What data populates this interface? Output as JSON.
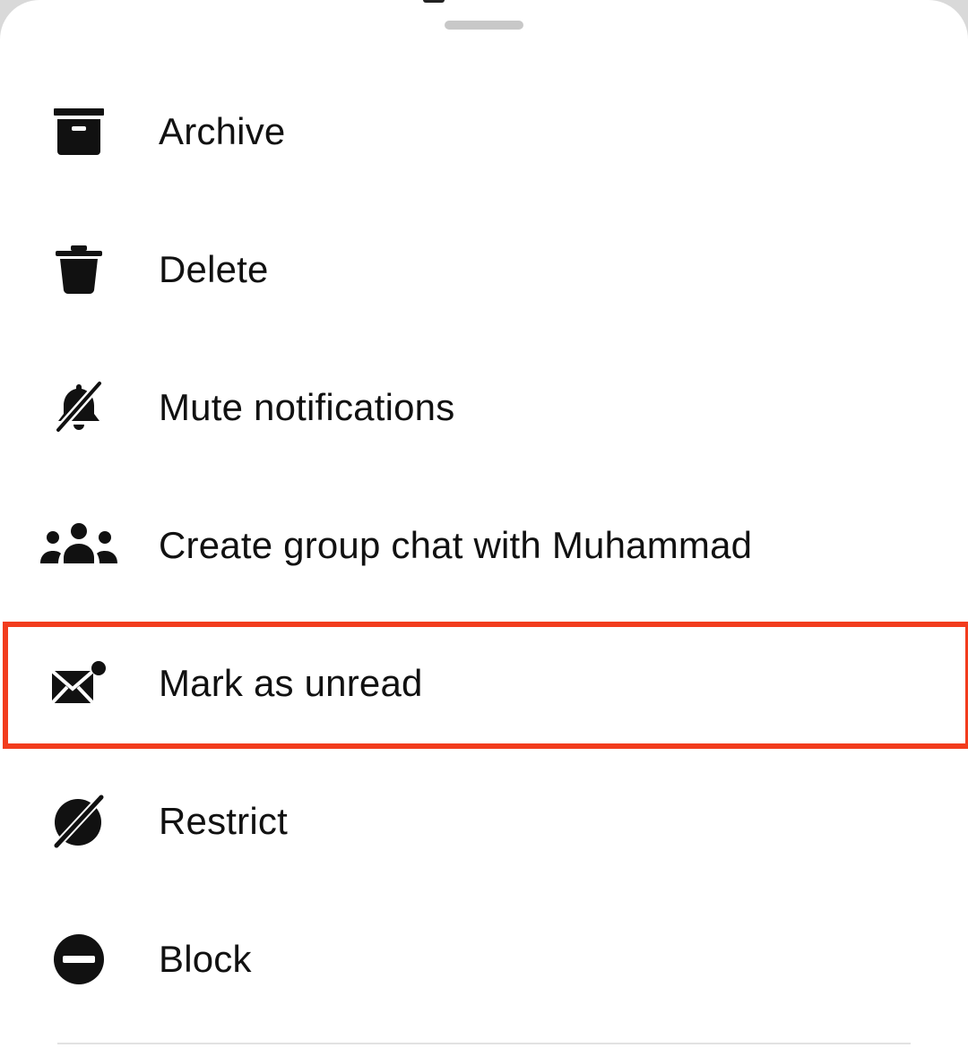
{
  "sheet": {
    "items": [
      {
        "label": "Archive",
        "icon": "archive-icon"
      },
      {
        "label": "Delete",
        "icon": "trash-icon"
      },
      {
        "label": "Mute notifications",
        "icon": "bell-off-icon"
      },
      {
        "label": "Create group chat with Muhammad",
        "icon": "group-icon"
      },
      {
        "label": "Mark as unread",
        "icon": "mail-unread-icon",
        "highlighted": true
      },
      {
        "label": "Restrict",
        "icon": "restrict-icon"
      },
      {
        "label": "Block",
        "icon": "block-icon"
      }
    ]
  },
  "colors": {
    "highlight_border": "#f23c1d",
    "icon": "#111111",
    "text": "#111111",
    "handle": "#c8c8c8"
  }
}
